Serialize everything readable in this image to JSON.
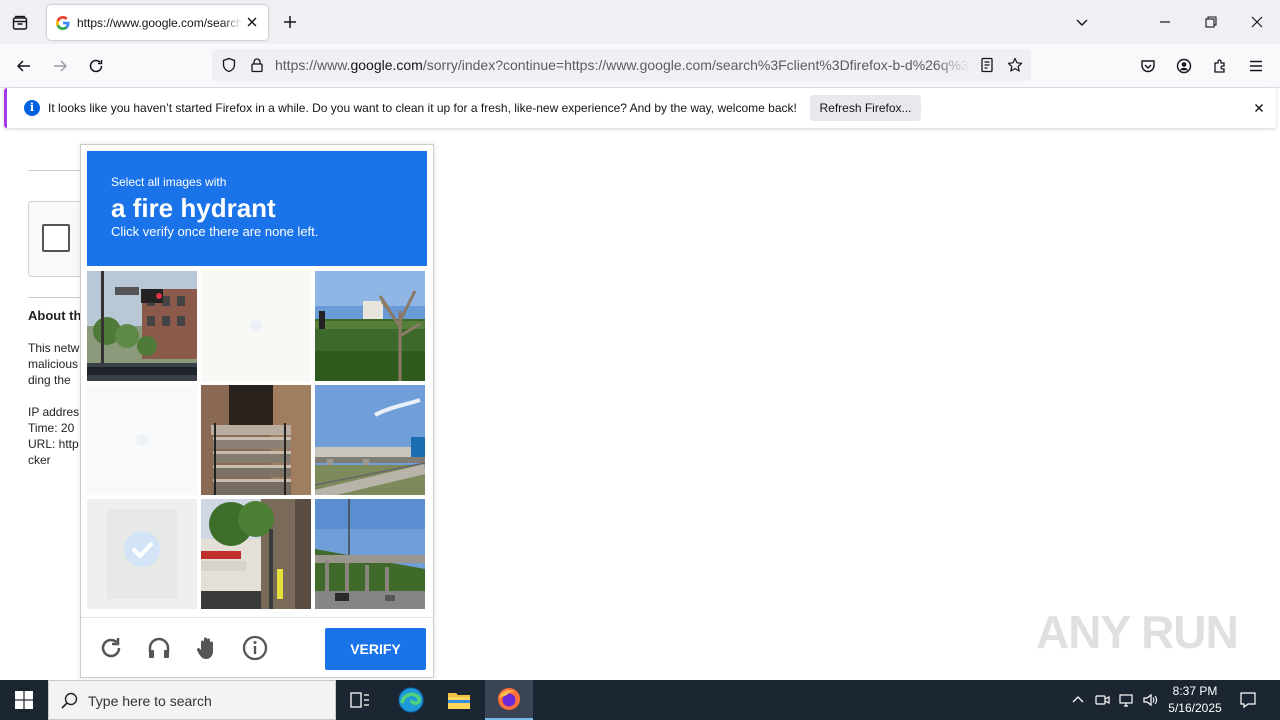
{
  "browser": {
    "tab_title": "https://www.google.com/search?client=firefox-b-d&q=",
    "url_prefix": "https://www.",
    "url_host": "google.com",
    "url_rest": "/sorry/index?continue=https://www.google.com/search%3Fclient%3Dfirefox-b-d%26q%3D"
  },
  "infobar": {
    "message": "It looks like you haven’t started Firefox in a while. Do you want to clean it up for a fresh, like-new experience? And by the way, welcome back!",
    "refresh_label": "Refresh Firefox..."
  },
  "background_page": {
    "about_heading": "About th",
    "lines": [
      "This netw",
      "malicious",
      "ding the"
    ],
    "meta_lines": [
      "IP addres",
      "Time: 20",
      "URL: http",
      "cker"
    ]
  },
  "challenge": {
    "prompt_small": "Select all images with",
    "prompt_target": "a fire hydrant",
    "prompt_instruction": "Click verify once there are none left.",
    "verify_label": "VERIFY",
    "footer_icons": [
      "reload-icon",
      "audio-icon",
      "hand-icon",
      "info-icon"
    ],
    "accent": "#1a73e8"
  },
  "watermark": "ANY RUN",
  "taskbar": {
    "search_placeholder": "Type here to search",
    "time": "8:37 PM",
    "date": "5/16/2025"
  }
}
